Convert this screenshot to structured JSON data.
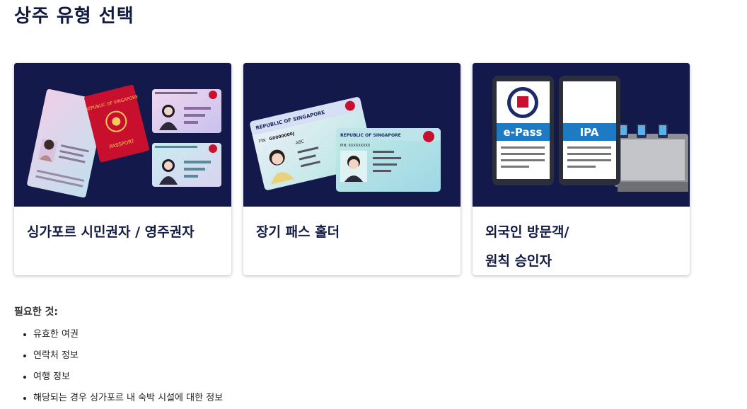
{
  "page": {
    "title": "상주 유형 선택"
  },
  "cards": [
    {
      "label": "싱가포르 시민권자 / 영주권자",
      "image": "passport-and-ic-illustration"
    },
    {
      "label": "장기 패스 홀더",
      "image": "long-term-pass-cards-illustration"
    },
    {
      "label_line1": "외국인 방문객/",
      "label_line2": "원칙 승인자",
      "image": "epass-ipa-phones-illustration"
    }
  ],
  "card_image_text": {
    "republic": "REPUBLIC OF SINGAPORE",
    "passport": "PASSPORT",
    "fin_label": "FIN",
    "fin_value": "G0000000J",
    "abc": "ABC",
    "pin": "PIN: XXXXXXXXX",
    "epass": "e-Pass",
    "ipa": "IPA"
  },
  "requirements": {
    "heading": "필요한 것:",
    "items": [
      "유효한 여권",
      "연락처 정보",
      "여행 정보",
      "해당되는 경우 싱가포르 내 숙박 시설에 대한 정보"
    ]
  },
  "colors": {
    "card_bg": "#131a4b",
    "title": "#111a3f",
    "accent_blue": "#1f7ac4",
    "passport_red": "#c8102e"
  }
}
